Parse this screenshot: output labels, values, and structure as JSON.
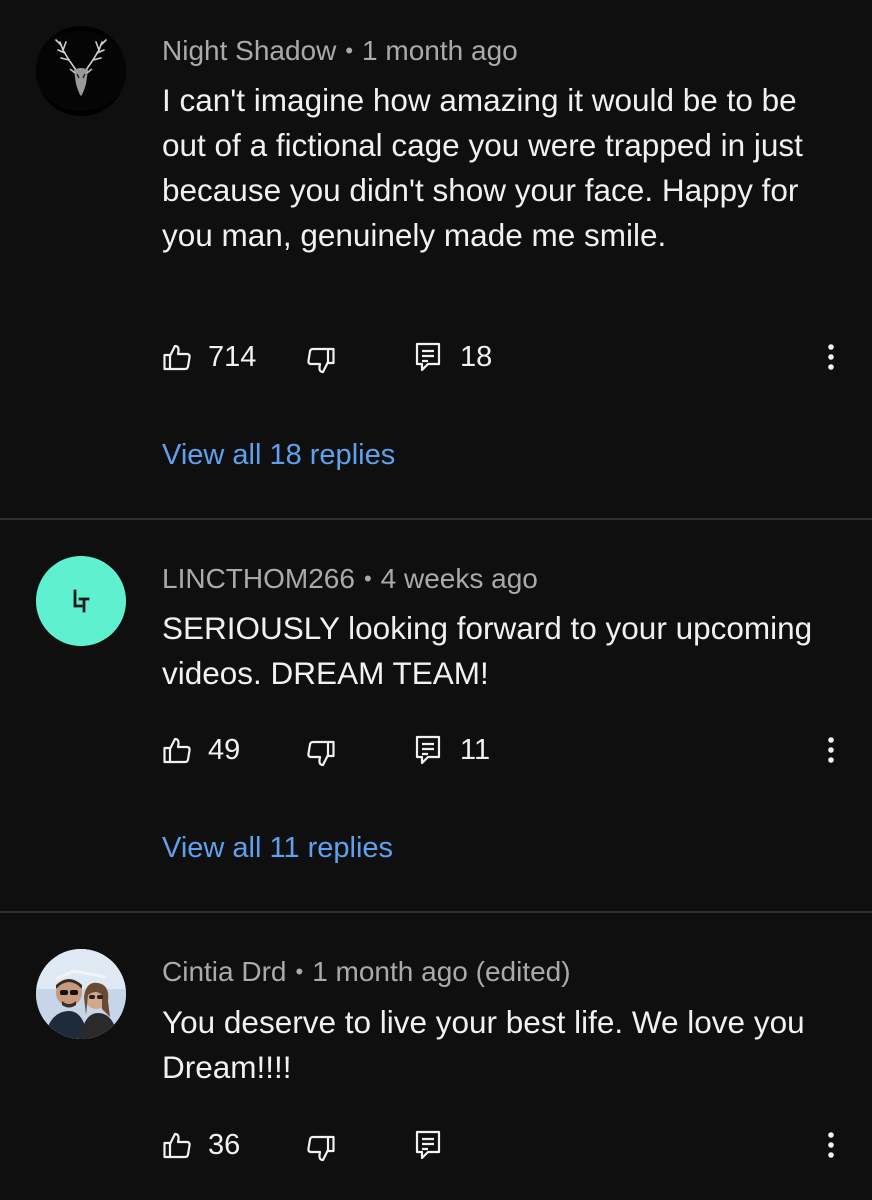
{
  "comments": [
    {
      "author": "Night Shadow",
      "timestamp": "1 month ago",
      "text": "I can't imagine how amazing it would be to be out of a fictional cage you were trapped in just because you didn't show your face. Happy for you man, genuinely made me smile.",
      "likes": "714",
      "replies_count": "18",
      "view_replies_label": "View all 18 replies",
      "avatar_icon": "deer-head-icon"
    },
    {
      "author": "LINCTHOM266",
      "timestamp": "4 weeks ago",
      "text": "SERIOUSLY looking forward to your upcoming videos. DREAM TEAM!",
      "likes": "49",
      "replies_count": "11",
      "view_replies_label": "View all 11 replies",
      "avatar_monogram": "LT",
      "avatar_color": "#5ff0cf"
    },
    {
      "author": "Cintia Drd",
      "timestamp": "1 month ago (edited)",
      "text": "You deserve to live your best life. We love you Dream!!!!",
      "likes": "36",
      "avatar_icon": "couple-photo"
    }
  ],
  "colors": {
    "background": "#0f0f0f",
    "link": "#5ea1ef",
    "meta_text": "#aaaaaa",
    "divider": "#303030"
  }
}
